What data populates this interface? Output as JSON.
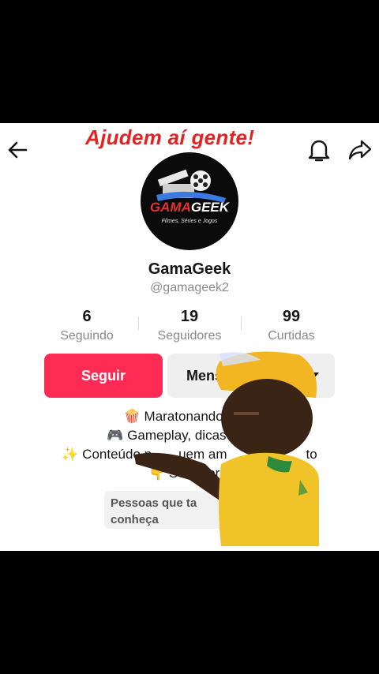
{
  "overlay_caption": "Ajudem aí gente!",
  "header": {
    "back_icon": "arrow-left-icon",
    "bell_icon": "bell-icon",
    "share_icon": "share-icon"
  },
  "avatar": {
    "brand_name_part1": "GAMA",
    "brand_name_part2": "GEEK",
    "brand_tagline": "Filmes, Séries e Jogos"
  },
  "profile": {
    "display_name": "GamaGeek",
    "username": "@gamageek2"
  },
  "stats": [
    {
      "value": "6",
      "label": "Seguindo"
    },
    {
      "value": "19",
      "label": "Seguidores"
    },
    {
      "value": "99",
      "label": "Curtidas"
    }
  ],
  "buttons": {
    "follow_label": "Seguir",
    "message_label": "Mensa"
  },
  "bio": {
    "line1": "🍿 Maratonando filme",
    "line2": "🎮 Gameplay, dicas e",
    "line3_start": "✨ Conteúdo p",
    "line3_mid": "uem am",
    "line3_end": "to",
    "line4": "👇 Se   e bora"
  },
  "suggested": {
    "line1": "Pessoas que ta",
    "line2": "conheça"
  },
  "colors": {
    "accent": "#fe2c55",
    "caption": "#e02424"
  }
}
